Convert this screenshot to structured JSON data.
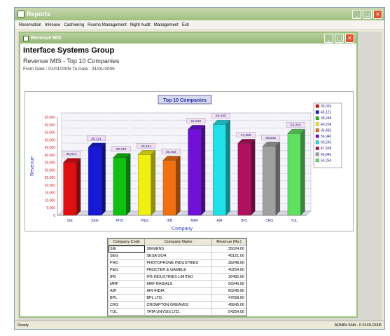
{
  "app": {
    "title": "Reports",
    "menu": [
      "Reservation",
      "InHouse",
      "Cashiering",
      "Rooms Management",
      "Night Audit",
      "Management",
      "Exit"
    ]
  },
  "child": {
    "title": "Revenue MIS"
  },
  "report": {
    "company": "Interface Systems Group",
    "title": "Revenue MIS - Top 10 Companies",
    "date_range": "From Date : 01/01/2005 To Date : 31/01/2005"
  },
  "chart_data": {
    "type": "bar",
    "title": "Top 10 Companies",
    "xlabel": "Company",
    "ylabel": "Revenue",
    "ylim": [
      0,
      65000
    ],
    "yticks": [
      "0",
      "5,000",
      "10,000",
      "15,000",
      "20,000",
      "25,000",
      "30,000",
      "35,000",
      "40,000",
      "45,000",
      "50,000",
      "55,000",
      "60,000",
      "65,000"
    ],
    "categories": [
      "SIE",
      "SEG",
      "PHO",
      "P&G",
      "IFB",
      "MRF",
      "AIR",
      "BPL",
      "CRG",
      "TUL"
    ],
    "values": [
      35024,
      45121,
      38248,
      40254,
      36482,
      56940,
      60245,
      47658,
      45845,
      54254
    ],
    "data_labels": [
      "35,024",
      "45,121",
      "38,248",
      "40,254",
      "36,482",
      "56,940",
      "60,245",
      "47,658",
      "45,845",
      "54,254"
    ],
    "colors": [
      "#e01010",
      "#1818d8",
      "#10c010",
      "#f0f010",
      "#f07010",
      "#7010d8",
      "#20e0e8",
      "#b01060",
      "#a0a0a0",
      "#60e060"
    ],
    "legend": [
      "35,024",
      "45,121",
      "38,248",
      "40,254",
      "36,482",
      "56,940",
      "60,245",
      "47,658",
      "45,845",
      "54,254"
    ],
    "legend_position": "right",
    "grid": true
  },
  "grid": {
    "headers": [
      "Company Code",
      "Company Name",
      "Revenue (Rs.)"
    ],
    "rows": [
      [
        "SIE",
        "SIEMENS",
        "35024.00"
      ],
      [
        "SEG",
        "SESA GOA",
        "45121.00"
      ],
      [
        "PHO",
        "PHOTOPHONE INDUSTRIES",
        "38248.00"
      ],
      [
        "P&G",
        "PROCTER & GAMBLE",
        "40254.00"
      ],
      [
        "IFB",
        "IFB INDUSTRIES LIMITED",
        "36482.00"
      ],
      [
        "MRF",
        "MRF RADIALS",
        "56940.00"
      ],
      [
        "AIR",
        "AIR INDIA",
        "60245.00"
      ],
      [
        "BPL",
        "BPL LTD.",
        "47658.00"
      ],
      [
        "CRG",
        "CROMPTON GREAVES",
        "45845.00"
      ],
      [
        "TUL",
        "TATA UNYSIS LTD.",
        "54254.00"
      ]
    ]
  },
  "status": {
    "left": "Ready",
    "right": "ADMIN Shift - 0 01/01/2005"
  }
}
